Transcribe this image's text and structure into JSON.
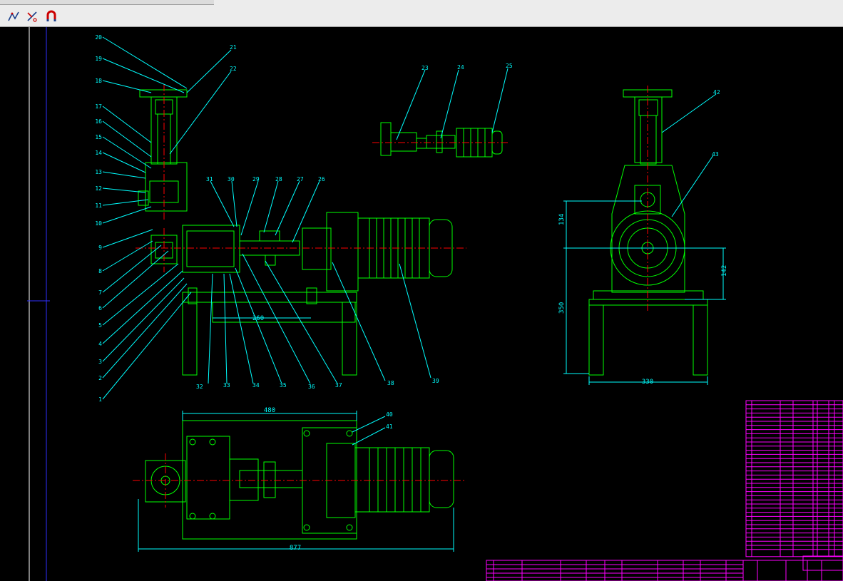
{
  "toolbar": {
    "buttons": [
      {
        "icon": "polyline-icon"
      },
      {
        "icon": "trim-icon"
      },
      {
        "icon": "snap-magnet-icon"
      }
    ]
  },
  "colors": {
    "background": "#000000",
    "green": "#00ff00",
    "cyan": "#00ffff",
    "red": "#ff0000",
    "magenta": "#ff00ff",
    "white": "#ffffff",
    "blue": "#0000ff"
  },
  "front_view": {
    "part_labels_left": [
      "20",
      "19",
      "18",
      "17",
      "16",
      "15",
      "14",
      "13",
      "12",
      "11",
      "10",
      "9",
      "8",
      "7",
      "6",
      "5",
      "4",
      "3",
      "2",
      "1"
    ],
    "part_labels_top": [
      "21",
      "22",
      "31",
      "30",
      "29",
      "28",
      "27",
      "26"
    ],
    "part_labels_bottom": [
      "32",
      "33",
      "34",
      "35",
      "36",
      "37",
      "38",
      "39"
    ],
    "dimension": "260"
  },
  "motor_detail": {
    "part_labels": [
      "23",
      "24",
      "25"
    ]
  },
  "side_view": {
    "part_labels": [
      "42",
      "43"
    ],
    "dim_vertical_top": "134",
    "dim_vertical_bottom": "350",
    "dim_right": "142",
    "dim_width": "330"
  },
  "top_view": {
    "part_labels": [
      "40",
      "41"
    ],
    "dim_top": "480",
    "dim_bottom": "877"
  }
}
